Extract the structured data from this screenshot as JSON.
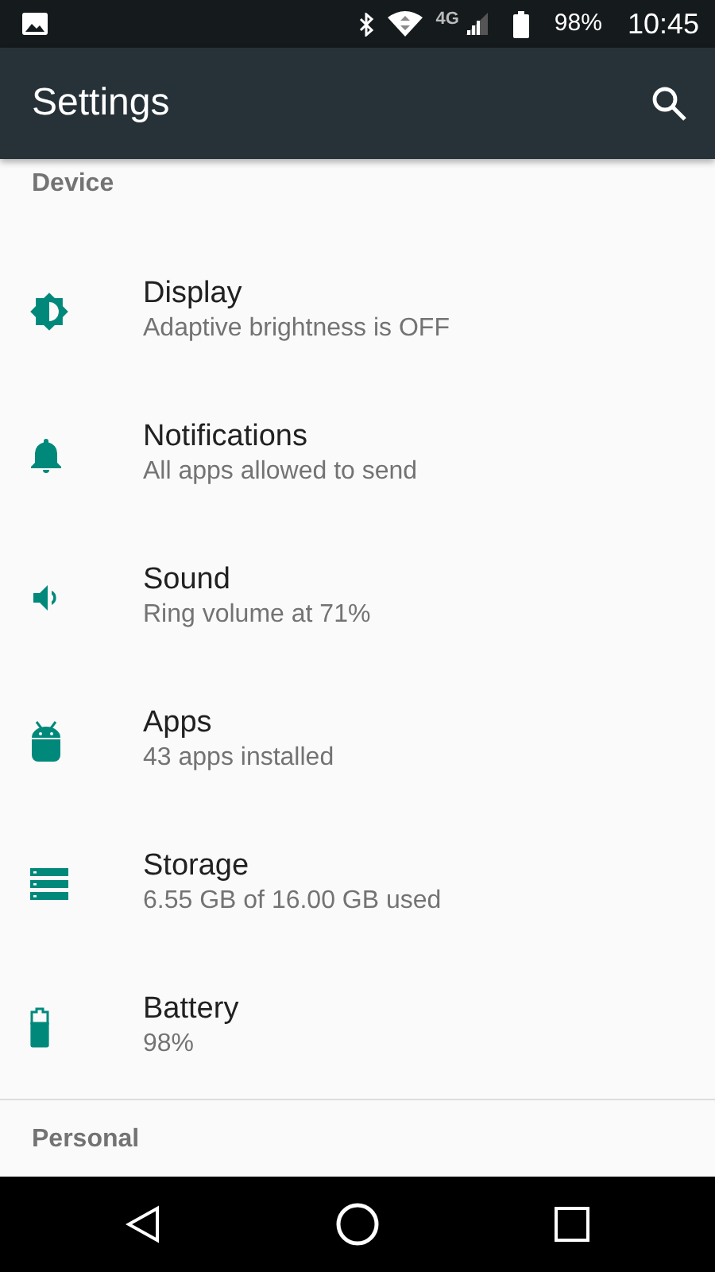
{
  "status_bar": {
    "network": "4G",
    "battery": "98%",
    "time": "10:45"
  },
  "toolbar": {
    "title": "Settings"
  },
  "sections": [
    {
      "header": "Device",
      "items": [
        {
          "title": "Display",
          "subtitle": "Adaptive brightness is OFF"
        },
        {
          "title": "Notifications",
          "subtitle": "All apps allowed to send"
        },
        {
          "title": "Sound",
          "subtitle": "Ring volume at 71%"
        },
        {
          "title": "Apps",
          "subtitle": "43 apps installed"
        },
        {
          "title": "Storage",
          "subtitle": "6.55 GB of 16.00 GB used"
        },
        {
          "title": "Battery",
          "subtitle": "98%"
        }
      ]
    },
    {
      "header": "Personal"
    }
  ]
}
